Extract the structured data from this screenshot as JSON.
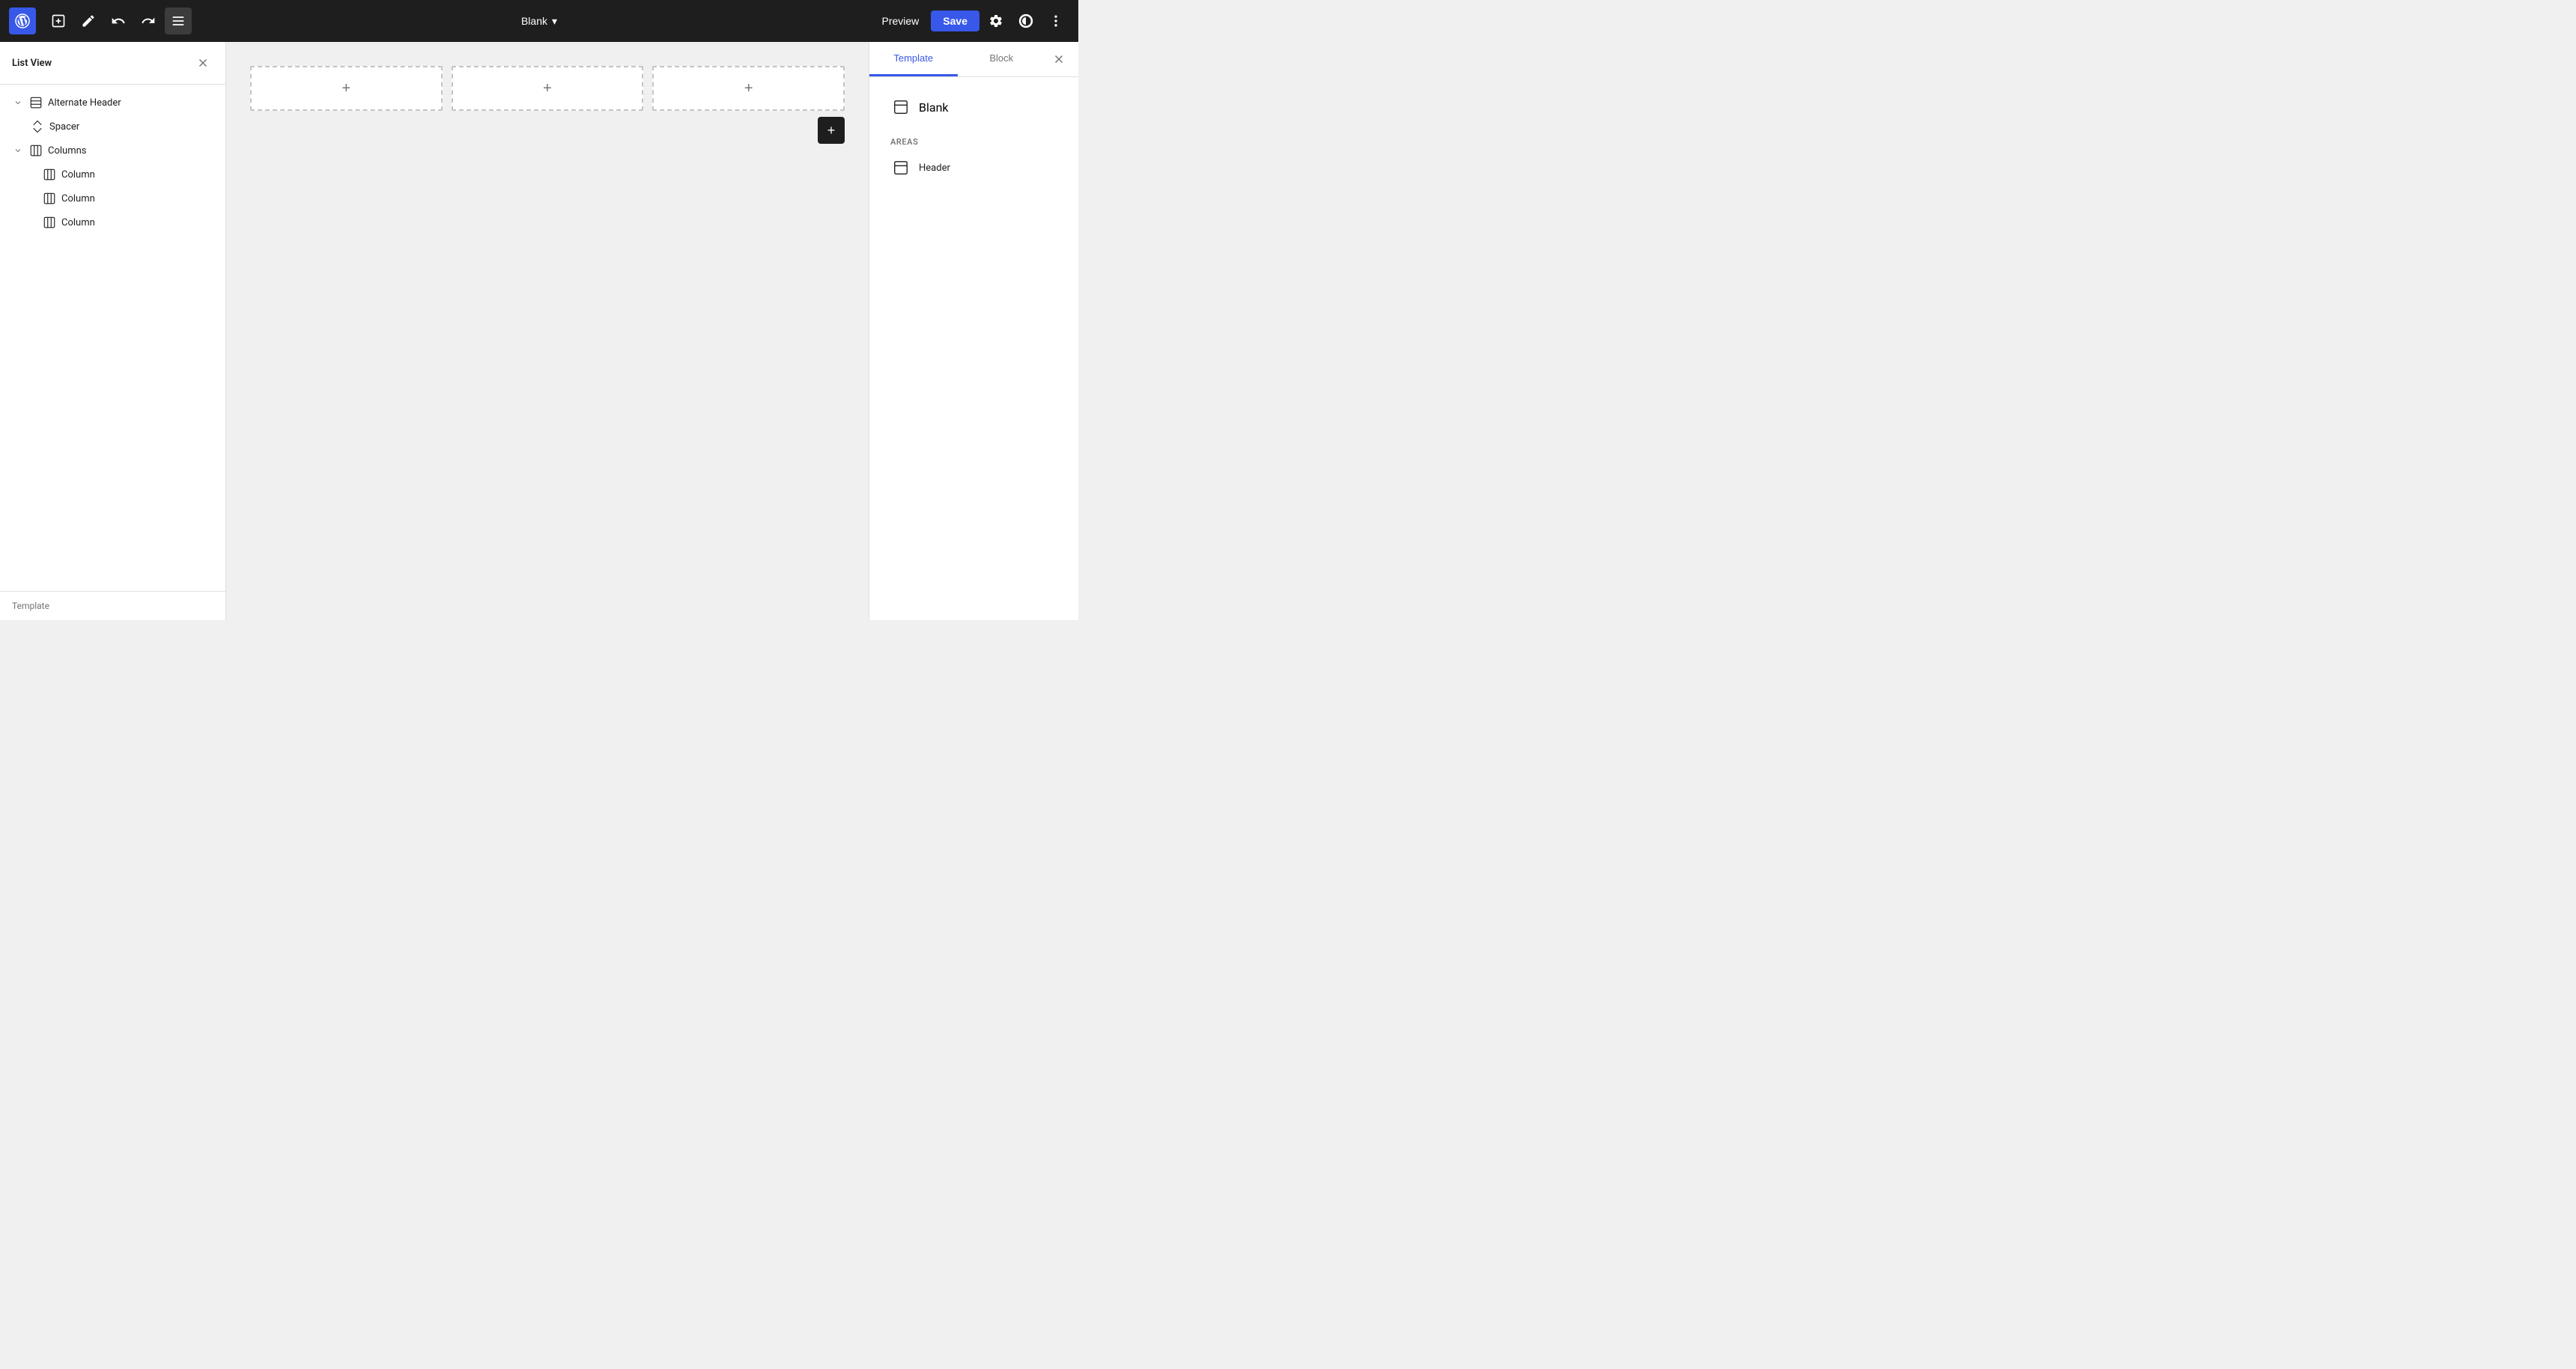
{
  "toolbar": {
    "wp_logo_alt": "WordPress",
    "add_label": "+",
    "undo_label": "Undo",
    "redo_label": "Redo",
    "list_view_label": "List View",
    "document_title": "Blank",
    "chevron_down": "▾",
    "preview_label": "Preview",
    "save_label": "Save",
    "settings_label": "Settings",
    "theme_label": "Theme styles",
    "more_label": "More options"
  },
  "left_sidebar": {
    "title": "List View",
    "close_label": "✕",
    "tree": [
      {
        "id": "alternate-header",
        "label": "Alternate Header",
        "indent": 0,
        "has_chevron": true,
        "chevron_open": true,
        "icon": "layout-icon"
      },
      {
        "id": "spacer",
        "label": "Spacer",
        "indent": 1,
        "has_chevron": false,
        "icon": "spacer-icon"
      },
      {
        "id": "columns",
        "label": "Columns",
        "indent": 0,
        "has_chevron": true,
        "chevron_open": true,
        "icon": "columns-icon"
      },
      {
        "id": "column1",
        "label": "Column",
        "indent": 2,
        "has_chevron": false,
        "icon": "column-icon"
      },
      {
        "id": "column2",
        "label": "Column",
        "indent": 2,
        "has_chevron": false,
        "icon": "column-icon"
      },
      {
        "id": "column3",
        "label": "Column",
        "indent": 2,
        "has_chevron": false,
        "icon": "column-icon"
      }
    ],
    "bottom_label": "Template"
  },
  "canvas": {
    "columns": [
      {
        "id": "col1",
        "plus": "+"
      },
      {
        "id": "col2",
        "plus": "+"
      },
      {
        "id": "col3",
        "plus": "+"
      }
    ],
    "add_block_label": "+"
  },
  "right_sidebar": {
    "tabs": [
      {
        "id": "template",
        "label": "Template",
        "active": true
      },
      {
        "id": "block",
        "label": "Block",
        "active": false
      }
    ],
    "close_label": "✕",
    "template_name": "Blank",
    "areas_label": "AREAS",
    "areas": [
      {
        "id": "header",
        "label": "Header"
      }
    ]
  }
}
